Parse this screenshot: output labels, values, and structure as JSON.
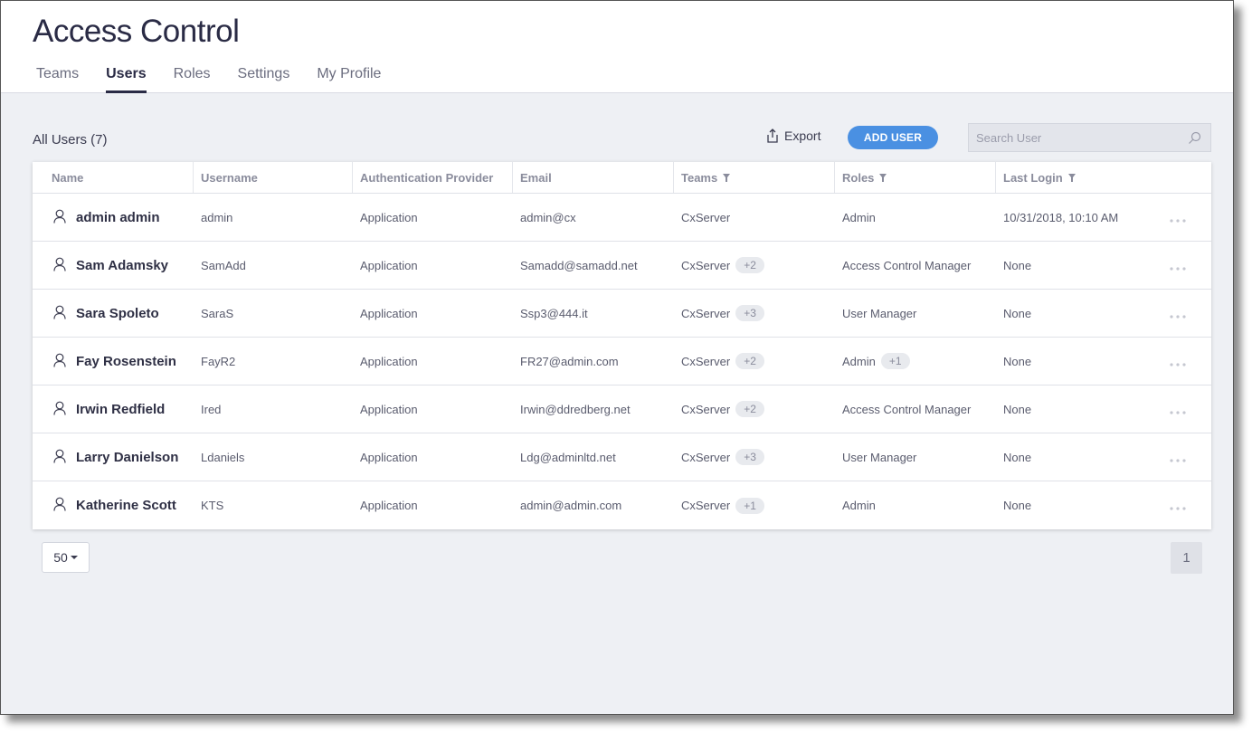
{
  "app": {
    "title": "Access Control"
  },
  "tabs": [
    {
      "label": "Teams"
    },
    {
      "label": "Users",
      "active": true
    },
    {
      "label": "Roles"
    },
    {
      "label": "Settings"
    },
    {
      "label": "My Profile"
    }
  ],
  "toolbar": {
    "list_title": "All Users (7)",
    "export_label": "Export",
    "add_user_label": "ADD USER",
    "search_placeholder": "Search User"
  },
  "table": {
    "columns": [
      "Name",
      "Username",
      "Authentication Provider",
      "Email",
      "Teams",
      "Roles",
      "Last Login"
    ],
    "rows": [
      {
        "name": "admin admin",
        "username": "admin",
        "provider": "Application",
        "email": "admin@cx",
        "team": "CxServer",
        "team_extra": "",
        "role": "Admin",
        "role_extra": "",
        "last_login": "10/31/2018, 10:10 AM"
      },
      {
        "name": "Sam Adamsky",
        "username": "SamAdd",
        "provider": "Application",
        "email": "Samadd@samadd.net",
        "team": "CxServer",
        "team_extra": "+2",
        "role": "Access Control Manager",
        "role_extra": "",
        "last_login": "None"
      },
      {
        "name": "Sara Spoleto",
        "username": "SaraS",
        "provider": "Application",
        "email": "Ssp3@444.it",
        "team": "CxServer",
        "team_extra": "+3",
        "role": "User Manager",
        "role_extra": "",
        "last_login": "None"
      },
      {
        "name": "Fay Rosenstein",
        "username": "FayR2",
        "provider": "Application",
        "email": "FR27@admin.com",
        "team": "CxServer",
        "team_extra": "+2",
        "role": "Admin",
        "role_extra": "+1",
        "last_login": "None"
      },
      {
        "name": "Irwin Redfield",
        "username": "Ired",
        "provider": "Application",
        "email": "Irwin@ddredberg.net",
        "team": "CxServer",
        "team_extra": "+2",
        "role": "Access Control Manager",
        "role_extra": "",
        "last_login": "None"
      },
      {
        "name": "Larry Danielson",
        "username": "Ldaniels",
        "provider": "Application",
        "email": "Ldg@adminltd.net",
        "team": "CxServer",
        "team_extra": "+3",
        "role": "User Manager",
        "role_extra": "",
        "last_login": "None"
      },
      {
        "name": "Katherine Scott",
        "username": "KTS",
        "provider": "Application",
        "email": "admin@admin.com",
        "team": "CxServer",
        "team_extra": "+1",
        "role": "Admin",
        "role_extra": "",
        "last_login": "None"
      }
    ]
  },
  "pagination": {
    "page_size": "50",
    "current_page": "1"
  },
  "colors": {
    "accent": "#4a90e2",
    "title": "#2a2b45",
    "background": "#eef0f4"
  },
  "icons": {
    "export": "export-icon",
    "search": "search-icon",
    "user": "user-icon",
    "filter": "filter-icon",
    "more": "more-icon"
  }
}
